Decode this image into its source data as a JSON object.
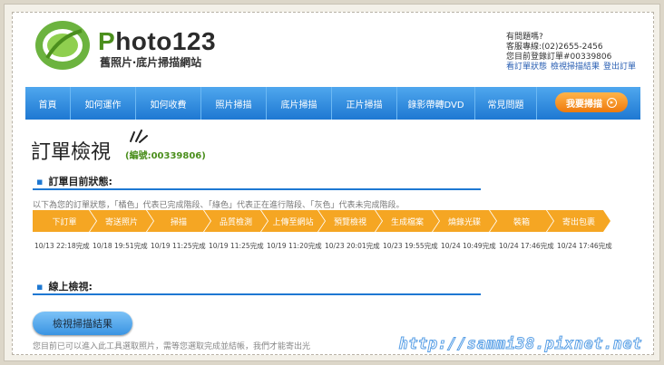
{
  "brand": {
    "name_prefix": "P",
    "name_rest": "hoto123",
    "tagline": "舊照片‧底片掃描網站"
  },
  "contact": {
    "question": "有問題嗎?",
    "hotline": "客服專線:(02)2655-2456",
    "current_order": "您目前登錄訂單#00339806",
    "link_status": "看訂單狀態",
    "link_results": "檢視掃描結果",
    "link_logout": "登出訂單"
  },
  "nav": {
    "items": [
      "首頁",
      "如何運作",
      "如何收費",
      "照片掃描",
      "底片掃描",
      "正片掃描",
      "錄影帶轉DVD",
      "常見問題"
    ],
    "cta_label": "我要掃描",
    "cta_icon": "▸"
  },
  "page": {
    "title": "訂單檢視",
    "order_number": "(編號:00339806)"
  },
  "status_section": {
    "heading": "訂單目前狀態:",
    "description": "以下為您的訂單狀態，「橘色」代表已完成階段、「綠色」代表正在進行階段、「灰色」代表未完成階段。",
    "steps": [
      "下訂單",
      "寄送照片",
      "掃描",
      "品質檢測",
      "上傳至網站",
      "預覽檢視",
      "生成檔案",
      "燒錄光碟",
      "裝箱",
      "寄出包裹"
    ],
    "dates": [
      "10/13 22:18完成",
      "10/18 19:51完成",
      "10/19 11:25完成",
      "10/19 11:25完成",
      "10/19 11:20完成",
      "10/23 20:01完成",
      "10/23 19:55完成",
      "10/24 10:49完成",
      "10/24 17:46完成",
      "10/24 17:46完成"
    ],
    "completed_color": "#f5a623"
  },
  "online_section": {
    "heading": "線上檢視:",
    "button_label": "檢視掃描結果",
    "note": "您目前已可以進入此工具選取照片，需等您選取完成並結帳，我們才能寄出光"
  },
  "watermark": "http://sammi38.pixnet.net",
  "colors": {
    "nav_blue": "#1e78d2",
    "brand_green": "#4b8f1d",
    "step_orange": "#f5a623",
    "cta_orange": "#ee7a0d"
  }
}
